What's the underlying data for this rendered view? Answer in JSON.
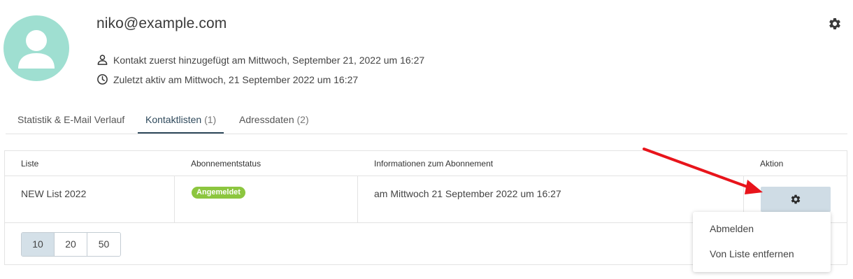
{
  "contact": {
    "email": "niko@example.com",
    "added_text": "Kontakt zuerst hinzugefügt am Mittwoch, September 21, 2022 um 16:27",
    "last_active_text": "Zuletzt aktiv am Mittwoch, 21 September 2022 um 16:27",
    "avatar_color": "#9fdfd1"
  },
  "tabs": [
    {
      "label": "Statistik & E-Mail Verlauf",
      "count": ""
    },
    {
      "label": "Kontaktlisten",
      "count": "(1)"
    },
    {
      "label": "Adressdaten",
      "count": "(2)"
    }
  ],
  "active_tab": "Kontaktlisten",
  "table": {
    "columns": [
      "Liste",
      "Abonnementstatus",
      "Informationen zum Abonnement",
      "Aktion"
    ],
    "rows": [
      {
        "list": "NEW List 2022",
        "status": "Angemeldet",
        "info": "am Mittwoch 21 September 2022 um 16:27",
        "action_icon": "gear-icon"
      }
    ]
  },
  "pagination": {
    "sizes": [
      "10",
      "20",
      "50"
    ],
    "selected": "10"
  },
  "action_menu": {
    "items": [
      "Abmelden",
      "Von Liste entfernen"
    ]
  },
  "colors": {
    "accent_dark": "#2f4a5c",
    "status_green": "#8cc63f",
    "action_button": "#cfdce5",
    "annotation_arrow": "#e8141b"
  }
}
